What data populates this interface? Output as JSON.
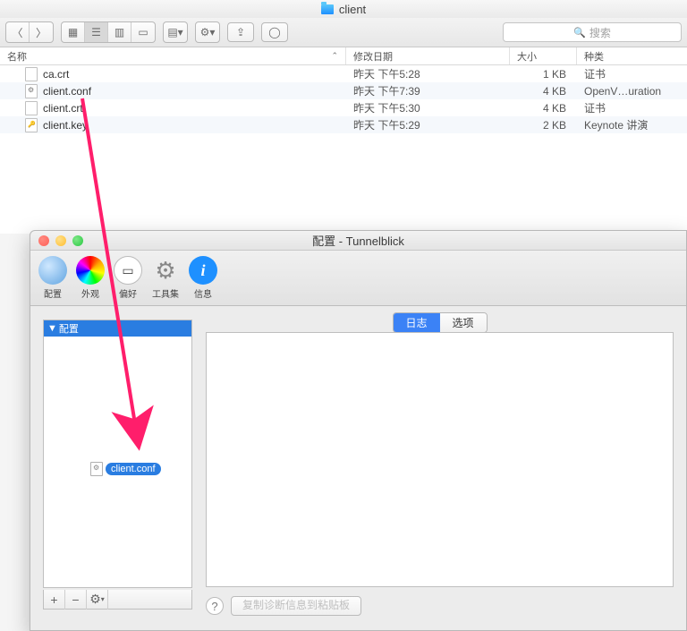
{
  "finder": {
    "title": "client",
    "search_placeholder": "搜索",
    "headers": {
      "name": "名称",
      "modified": "修改日期",
      "size": "大小",
      "kind": "种类"
    },
    "rows": [
      {
        "name": "ca.crt",
        "modified": "昨天 下午5:28",
        "size": "1 KB",
        "kind": "证书"
      },
      {
        "name": "client.conf",
        "modified": "昨天 下午7:39",
        "size": "4 KB",
        "kind": "OpenV…uration"
      },
      {
        "name": "client.crt",
        "modified": "昨天 下午5:30",
        "size": "4 KB",
        "kind": "证书"
      },
      {
        "name": "client.key",
        "modified": "昨天 下午5:29",
        "size": "2 KB",
        "kind": "Keynote 讲演"
      }
    ]
  },
  "tunnelblick": {
    "title": "配置 - Tunnelblick",
    "toolbar": {
      "config": "配置",
      "appearance": "外观",
      "pref": "偏好",
      "toolkit": "工具集",
      "info": "信息"
    },
    "sidebar": {
      "header": "配置",
      "drop_file": "client.conf"
    },
    "tabs": {
      "log": "日志",
      "options": "选项"
    },
    "bottom": {
      "copy_btn": "复制诊断信息到粘贴板"
    },
    "footer": {
      "plus": "+",
      "minus": "−",
      "gear": "⚙"
    }
  }
}
